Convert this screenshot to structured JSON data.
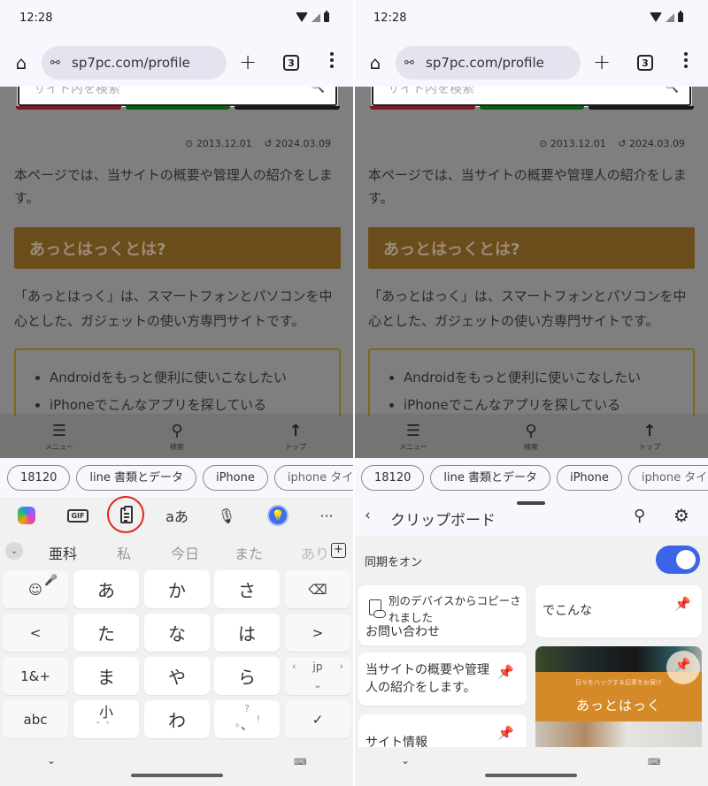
{
  "status_bar": {
    "time": "12:28"
  },
  "browser": {
    "url": "sp7pc.com/profile",
    "tab_count": "3",
    "home_icon": "home-icon",
    "new_tab_icon": "plus-icon",
    "menu_icon": "more-vert-icon"
  },
  "webpage": {
    "search_placeholder": "サイト内を検索",
    "tab_colors": [
      "#8a1c2c",
      "#0a6a12",
      "#1b1b1b"
    ],
    "published": "2013.12.01",
    "updated": "2024.03.09",
    "intro": "本ページでは、当サイトの概要や管理人の紹介をします。",
    "heading": "あっとはっくとは?",
    "description": "「あっとはっく」は、スマートフォンとパソコンを中心とした、ガジェットの使い方専門サイトです。",
    "bullets": [
      "Androidをもっと便利に使いこなしたい",
      "iPhoneでこんなアプリを探している"
    ],
    "bottom_nav": [
      {
        "icon": "menu-icon",
        "label": "メニュー"
      },
      {
        "icon": "search-icon",
        "label": "検索"
      },
      {
        "icon": "arrow-up-icon",
        "label": "トップ"
      }
    ]
  },
  "suggestion_chips": [
    "18120",
    "line 書類とデータ",
    "iPhone",
    "iphone タイ"
  ],
  "keyboard": {
    "toolbar": [
      "copilot-icon",
      "gif-icon",
      "clipboard-icon",
      "translate-icon",
      "mic-icon",
      "lightbulb-icon",
      "more-icon"
    ],
    "toolbar_labels": {
      "gif": "GIF",
      "translate": "aあ",
      "more": "···"
    },
    "candidates": [
      "亜科",
      "私",
      "今日",
      "また",
      "あり"
    ],
    "rows": [
      [
        "emoji",
        "あ",
        "か",
        "さ",
        "backspace"
      ],
      [
        "<",
        "た",
        "な",
        "は",
        ">"
      ],
      [
        "1&+",
        "ま",
        "や",
        "ら",
        "space-jp"
      ],
      [
        "abc",
        "小",
        "わ",
        "punct",
        "enter"
      ]
    ],
    "space_label": "jp",
    "small_sub": "゛゜",
    "punct": {
      "top": "?",
      "left": "。",
      "mid": "、",
      "right": "!"
    },
    "enter_label": "✓",
    "highlight_color": "#e8241a"
  },
  "clipboard": {
    "title": "クリップボード",
    "sync_label": "同期をオン",
    "sync_on": true,
    "accent": "#3b64e8",
    "items": [
      {
        "text": "別のデバイスからコピーされました",
        "sub": "お問い合わせ",
        "type": "cloud"
      },
      {
        "text": "でこんな",
        "type": "text"
      },
      {
        "text": "当サイトの概要や管理人の紹介をします。",
        "type": "text"
      },
      {
        "text": "サイト情報",
        "type": "text"
      },
      {
        "type": "image",
        "image_caption_small": "日々をハックする記事をお届け",
        "image_caption": "あっとはっく"
      }
    ]
  }
}
